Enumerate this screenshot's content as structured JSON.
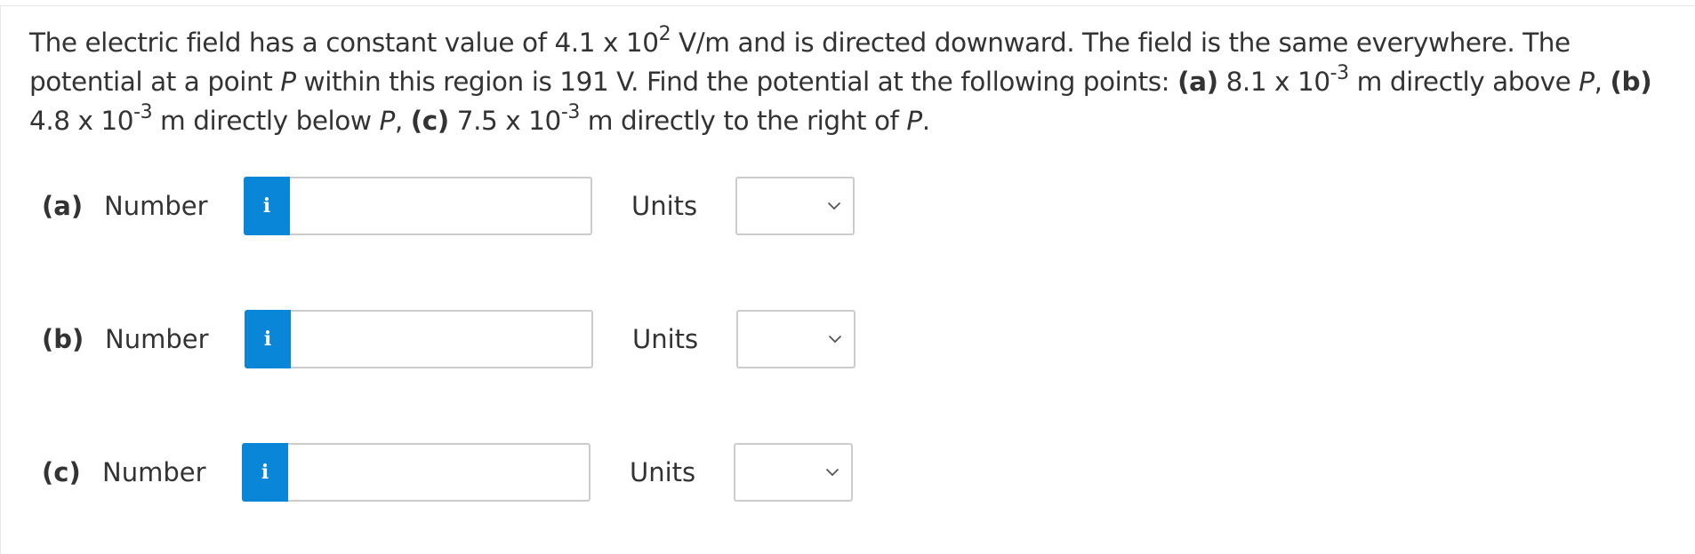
{
  "question": {
    "s1": "The electric field has a constant value of 4.1 x 10",
    "s1_exp": "2",
    "s2": " V/m and is directed downward. The field is the same everywhere. The potential at a point ",
    "s2_p": "P",
    "s3": " within this region is 191 V. Find the potential at the following points: ",
    "a_label": "(a)",
    "a_text": " 8.1 x 10",
    "a_exp": "-3",
    "a_text2": " m directly above ",
    "a_p": "P",
    "a_sep": ", ",
    "b_label": "(b)",
    "b_text": " 4.8 x 10",
    "b_exp": "-3",
    "b_text2": " m directly below ",
    "b_p": "P",
    "b_sep": ", ",
    "c_label": "(c)",
    "c_text": " 7.5 x 10",
    "c_exp": "-3",
    "c_text2": " m directly to the right of ",
    "c_p": "P",
    "c_end": "."
  },
  "parts": [
    {
      "label": "(a)",
      "number_label": "Number",
      "info_icon": "i",
      "number_value": "",
      "units_label": "Units",
      "units_selected": ""
    },
    {
      "label": "(b)",
      "number_label": "Number",
      "info_icon": "i",
      "number_value": "",
      "units_label": "Units",
      "units_selected": ""
    },
    {
      "label": "(c)",
      "number_label": "Number",
      "info_icon": "i",
      "number_value": "",
      "units_label": "Units",
      "units_selected": ""
    }
  ],
  "colors": {
    "info_button": "#0a86d8",
    "text": "#333333",
    "border": "#cccccc"
  },
  "icons": {
    "info": "info-icon",
    "dropdown": "chevron-down-icon"
  }
}
